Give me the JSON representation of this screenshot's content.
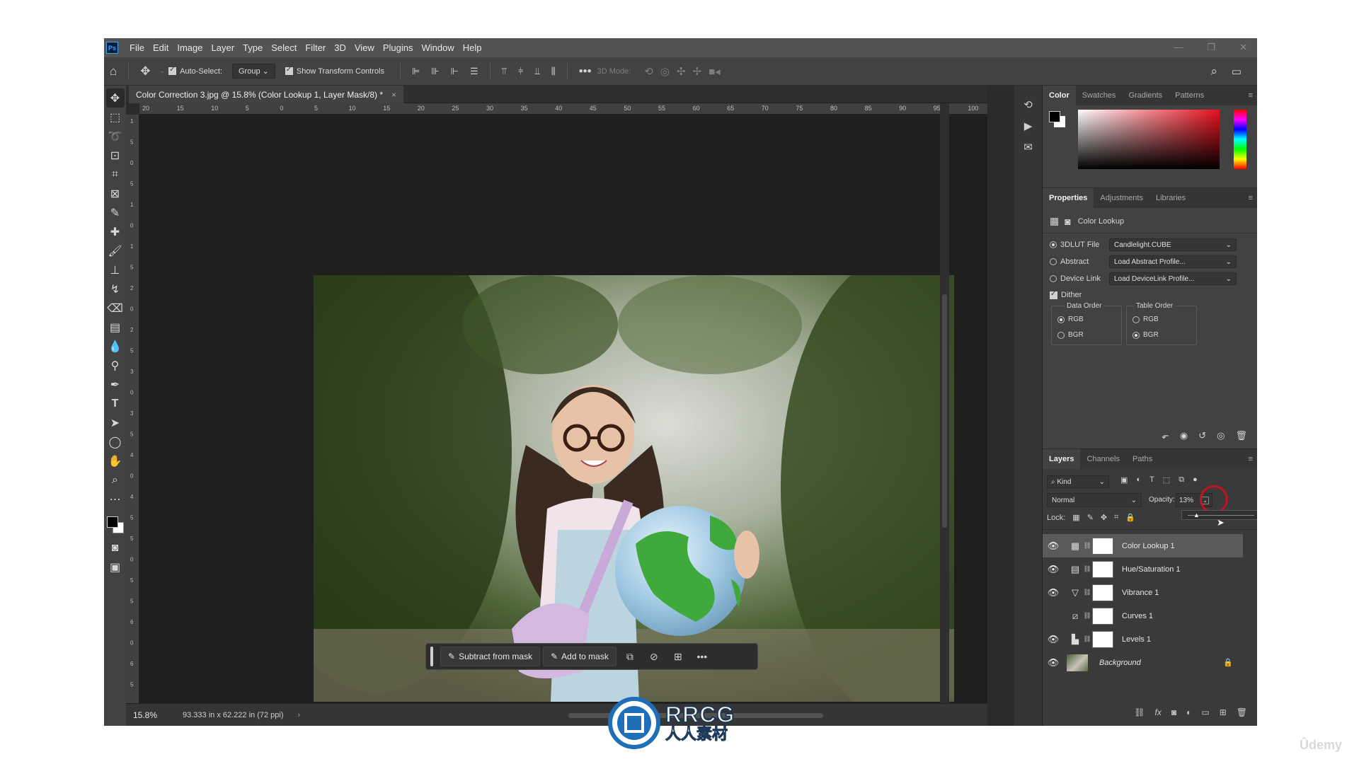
{
  "app": {
    "logo": "Ps"
  },
  "menu": [
    "File",
    "Edit",
    "Image",
    "Layer",
    "Type",
    "Select",
    "Filter",
    "3D",
    "View",
    "Plugins",
    "Window",
    "Help"
  ],
  "window_controls": [
    "—",
    "❐",
    "✕"
  ],
  "options": {
    "auto_select_label": "Auto-Select:",
    "auto_select_value": "Group",
    "transform_label": "Show Transform Controls",
    "mode_3d_label": "3D Mode:"
  },
  "document": {
    "tab_title": "Color Correction 3.jpg @ 15.8% (Color Lookup 1, Layer Mask/8) *",
    "zoom": "15.8%",
    "size": "93.333 in x 62.222 in (72 ppi)"
  },
  "ruler_h": [
    "20",
    "15",
    "10",
    "5",
    "0",
    "5",
    "10",
    "15",
    "20",
    "25",
    "30",
    "35",
    "40",
    "45",
    "50",
    "55",
    "60",
    "65",
    "70",
    "75",
    "80",
    "85",
    "90",
    "95",
    "100"
  ],
  "ruler_v": [
    "1",
    "5",
    "0",
    "5",
    "1",
    "0",
    "1",
    "5",
    "2",
    "0",
    "2",
    "5",
    "3",
    "0",
    "3",
    "5",
    "4",
    "0",
    "4",
    "5",
    "5",
    "0",
    "5",
    "5",
    "6",
    "0",
    "6",
    "5"
  ],
  "mask_bar": {
    "subtract": "Subtract from mask",
    "add": "Add to mask"
  },
  "color_panel": {
    "tabs": [
      "Color",
      "Swatches",
      "Gradients",
      "Patterns"
    ],
    "hue_color": "#e8101c"
  },
  "properties": {
    "tabs": [
      "Properties",
      "Adjustments",
      "Libraries"
    ],
    "adjustment_name": "Color Lookup",
    "lut_label": "3DLUT File",
    "lut_value": "Candlelight.CUBE",
    "abstract_label": "Abstract",
    "abstract_value": "Load Abstract Profile...",
    "devicelink_label": "Device Link",
    "devicelink_value": "Load DeviceLink Profile...",
    "dither_label": "Dither",
    "data_order_title": "Data Order",
    "data_order": [
      "RGB",
      "BGR"
    ],
    "table_order_title": "Table Order",
    "table_order": [
      "RGB",
      "BGR"
    ]
  },
  "layers_panel": {
    "tabs": [
      "Layers",
      "Channels",
      "Paths"
    ],
    "kind_label": "Kind",
    "blend_mode": "Normal",
    "opacity_label": "Opacity:",
    "opacity_value": "13%",
    "lock_label": "Lock:",
    "layers": [
      {
        "name": "Color Lookup 1",
        "type_icon": "grid-icon",
        "visible": true,
        "active": true
      },
      {
        "name": "Hue/Saturation 1",
        "type_icon": "hue-icon",
        "visible": true,
        "active": false
      },
      {
        "name": "Vibrance 1",
        "type_icon": "triangle-icon",
        "visible": true,
        "active": false
      },
      {
        "name": "Curves 1",
        "type_icon": "curves-icon",
        "visible": false,
        "active": false
      },
      {
        "name": "Levels 1",
        "type_icon": "levels-icon",
        "visible": true,
        "active": false
      },
      {
        "name": "Background",
        "type_icon": "thumbnail",
        "visible": true,
        "active": false
      }
    ]
  },
  "watermark": {
    "title": "RRCG",
    "subtitle": "人人素材"
  },
  "udemy": "Ûdemy"
}
